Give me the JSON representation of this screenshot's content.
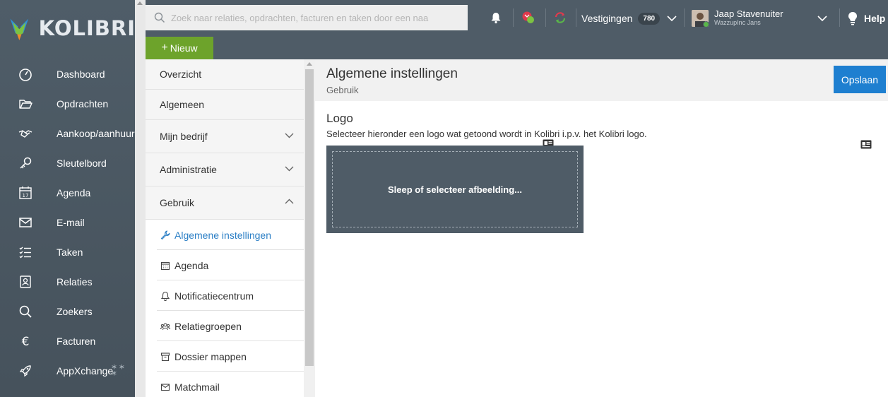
{
  "brand": {
    "name": "KOLIBRI"
  },
  "sidebar": {
    "items": [
      {
        "label": "Dashboard",
        "icon": "dashboard-icon"
      },
      {
        "label": "Opdrachten",
        "icon": "folder-open-icon"
      },
      {
        "label": "Aankoop/aanhuur",
        "icon": "handshake-icon"
      },
      {
        "label": "Sleutelbord",
        "icon": "key-icon"
      },
      {
        "label": "Agenda",
        "icon": "calendar-17-icon"
      },
      {
        "label": "E-mail",
        "icon": "envelope-icon"
      },
      {
        "label": "Taken",
        "icon": "task-list-icon"
      },
      {
        "label": "Relaties",
        "icon": "contact-card-icon"
      },
      {
        "label": "Zoekers",
        "icon": "search-icon"
      },
      {
        "label": "Facturen",
        "icon": "euro-icon"
      },
      {
        "label": "AppXchange",
        "icon": "rocket-icon"
      }
    ]
  },
  "header": {
    "search_placeholder": "Zoek naar relaties, opdrachten, facturen en taken door een naa",
    "branches_label": "Vestigingen",
    "branches_count": "780",
    "user_name": "Jaap Stavenuiter",
    "user_company": "WazzupInc Jans",
    "help_label": "Help"
  },
  "toolbar": {
    "new_label": "Nieuw"
  },
  "settings_menu": {
    "items": [
      {
        "label": "Overzicht"
      },
      {
        "label": "Algemeen"
      },
      {
        "label": "Mijn bedrijf"
      },
      {
        "label": "Administratie"
      },
      {
        "label": "Gebruik"
      }
    ],
    "sub_items": [
      {
        "label": "Algemene instellingen",
        "icon": "wrench-icon",
        "active": true
      },
      {
        "label": "Agenda",
        "icon": "calendar-icon"
      },
      {
        "label": "Notificatiecentrum",
        "icon": "bell-icon"
      },
      {
        "label": "Relatiegroepen",
        "icon": "users-icon"
      },
      {
        "label": "Dossier mappen",
        "icon": "archive-box-icon"
      },
      {
        "label": "Matchmail",
        "icon": "envelope-icon"
      }
    ]
  },
  "content": {
    "title": "Algemene instellingen",
    "subtitle": "Gebruik",
    "save_label": "Opslaan",
    "section_title": "Logo",
    "section_description": "Selecteer hieronder een logo wat getoond wordt in Kolibri i.p.v. het Kolibri logo.",
    "dropzone_label": "Sleep of selecteer afbeelding..."
  },
  "colors": {
    "sidebar_bg": "#4f5d68",
    "header_bg": "#4f5c67",
    "new_button": "#6da32b",
    "save_button": "#1e7fd0",
    "active_link": "#2a7ec5"
  }
}
